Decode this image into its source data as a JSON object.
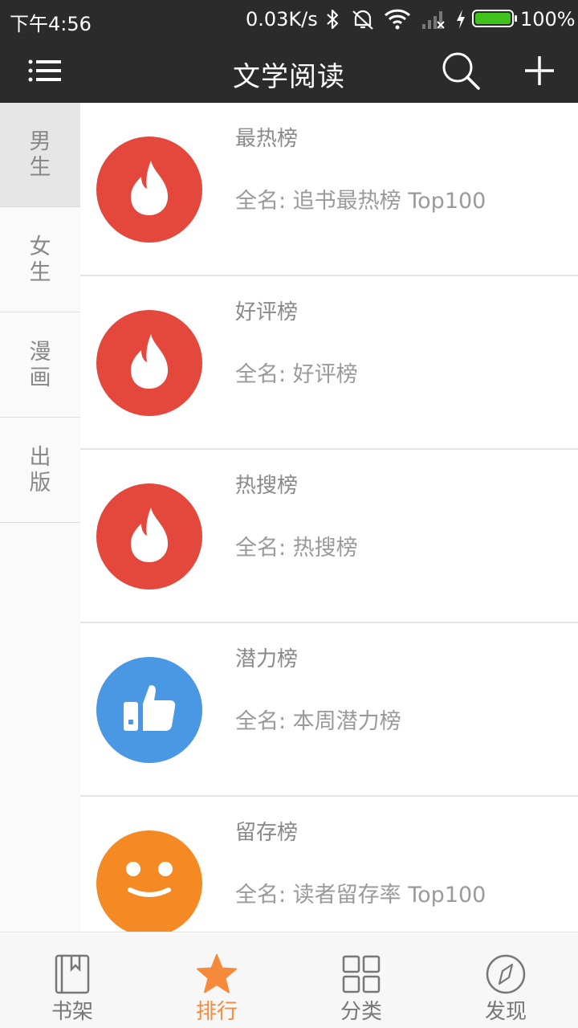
{
  "status_bar": {
    "time": "下午4:56",
    "net_speed": "0.03K/s",
    "battery_percent": "100%",
    "battery_level": 1.0,
    "icons": [
      "bluetooth-icon",
      "mute-vibrate-icon",
      "wifi-icon",
      "signal-icon",
      "charging-icon",
      "battery-icon"
    ]
  },
  "app_bar": {
    "title": "文学阅读",
    "icons": [
      "menu-icon",
      "search-icon",
      "add-icon"
    ]
  },
  "side_tabs": [
    {
      "label": "男生",
      "active": true
    },
    {
      "label": "女生",
      "active": false
    },
    {
      "label": "漫画",
      "active": false
    },
    {
      "label": "出版",
      "active": false
    }
  ],
  "rankings": [
    {
      "name": "最热榜",
      "full": "全名: 追书最热榜 Top100",
      "icon": "flame-icon",
      "color": "#e4473b"
    },
    {
      "name": "好评榜",
      "full": "全名: 好评榜",
      "icon": "flame-icon",
      "color": "#e4473b"
    },
    {
      "name": "热搜榜",
      "full": "全名: 热搜榜",
      "icon": "flame-icon",
      "color": "#e4473b"
    },
    {
      "name": "潜力榜",
      "full": "全名: 本周潜力榜",
      "icon": "thumbs-up-icon",
      "color": "#4a97e4"
    },
    {
      "name": "留存榜",
      "full": "全名: 读者留存率 Top100",
      "icon": "smiley-icon",
      "color": "#f58a24"
    }
  ],
  "bottom_nav": [
    {
      "label": "书架",
      "icon": "bookshelf-icon",
      "active": false
    },
    {
      "label": "排行",
      "icon": "star-icon",
      "active": true
    },
    {
      "label": "分类",
      "icon": "grid-icon",
      "active": false
    },
    {
      "label": "发现",
      "icon": "compass-icon",
      "active": false
    }
  ],
  "colors": {
    "bar_background": "#2b2b2b",
    "accent": "#f58a3b",
    "battery_green": "#3fc21c"
  }
}
